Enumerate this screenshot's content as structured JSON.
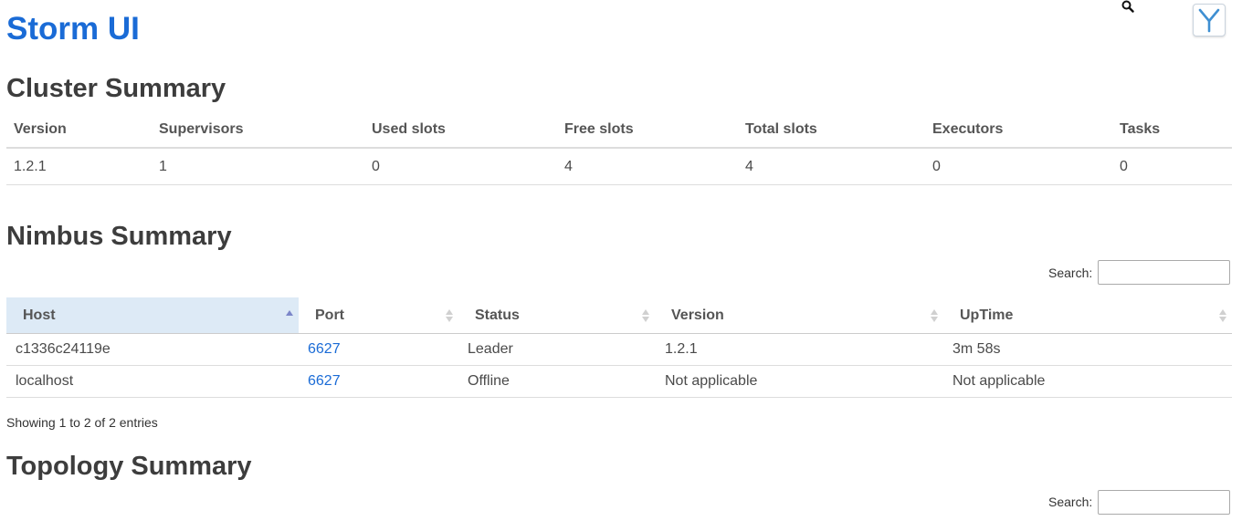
{
  "app": {
    "title": "Storm UI",
    "logo_icon": "storm-logo-icon",
    "search_icon": "search-icon"
  },
  "cluster": {
    "title": "Cluster Summary",
    "columns": [
      "Version",
      "Supervisors",
      "Used slots",
      "Free slots",
      "Total slots",
      "Executors",
      "Tasks"
    ],
    "row": [
      "1.2.1",
      "1",
      "0",
      "4",
      "4",
      "0",
      "0"
    ]
  },
  "nimbus": {
    "title": "Nimbus Summary",
    "search_label": "Search:",
    "search_value": "",
    "columns": [
      "Host",
      "Port",
      "Status",
      "Version",
      "UpTime"
    ],
    "sorted_column": "Host",
    "rows": [
      [
        "c1336c24119e",
        "6627",
        "Leader",
        "1.2.1",
        "3m 58s"
      ],
      [
        "localhost",
        "6627",
        "Offline",
        "Not applicable",
        "Not applicable"
      ]
    ],
    "info": "Showing 1 to 2 of 2 entries"
  },
  "topology": {
    "title": "Topology Summary",
    "search_label": "Search:",
    "search_value": ""
  },
  "colors": {
    "accent": "#1a6bd6",
    "sorted_header_bg": "#ddeaf6",
    "heading": "#3d3d3d"
  }
}
